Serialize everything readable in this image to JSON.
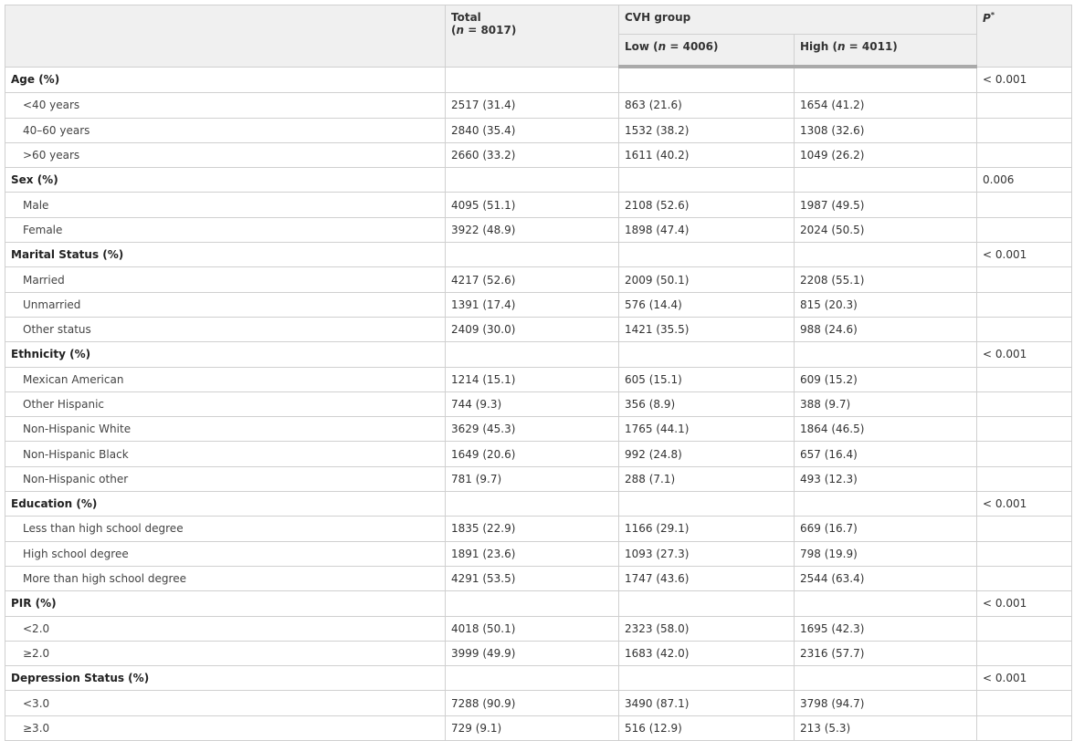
{
  "header": {
    "total_label": "Total",
    "total_n": "(n = 8017)",
    "cvh_group_label": "CVH group",
    "low_label": "Low (n = 4006)",
    "high_label": "High (n = 4011)",
    "p_label": "P",
    "p_sup": "*"
  },
  "rows": [
    {
      "type": "group",
      "label": "Age (%)",
      "total": "",
      "low": "",
      "high": "",
      "p": "< 0.001"
    },
    {
      "type": "item",
      "label": "<40 years",
      "total": "2517 (31.4)",
      "low": "863 (21.6)",
      "high": "1654 (41.2)",
      "p": ""
    },
    {
      "type": "item",
      "label": "40–60 years",
      "total": "2840 (35.4)",
      "low": "1532 (38.2)",
      "high": "1308 (32.6)",
      "p": ""
    },
    {
      "type": "item",
      "label": ">60 years",
      "total": "2660 (33.2)",
      "low": "1611 (40.2)",
      "high": "1049 (26.2)",
      "p": ""
    },
    {
      "type": "group",
      "label": "Sex (%)",
      "total": "",
      "low": "",
      "high": "",
      "p": "0.006"
    },
    {
      "type": "item",
      "label": "Male",
      "total": "4095 (51.1)",
      "low": "2108 (52.6)",
      "high": "1987 (49.5)",
      "p": ""
    },
    {
      "type": "item",
      "label": "Female",
      "total": "3922 (48.9)",
      "low": "1898 (47.4)",
      "high": "2024 (50.5)",
      "p": ""
    },
    {
      "type": "group",
      "label": "Marital Status (%)",
      "total": "",
      "low": "",
      "high": "",
      "p": "< 0.001"
    },
    {
      "type": "item",
      "label": "Married",
      "total": "4217 (52.6)",
      "low": "2009 (50.1)",
      "high": "2208 (55.1)",
      "p": ""
    },
    {
      "type": "item",
      "label": "Unmarried",
      "total": "1391 (17.4)",
      "low": "576 (14.4)",
      "high": "815 (20.3)",
      "p": ""
    },
    {
      "type": "item",
      "label": "Other status",
      "total": "2409 (30.0)",
      "low": "1421 (35.5)",
      "high": "988 (24.6)",
      "p": ""
    },
    {
      "type": "group",
      "label": "Ethnicity (%)",
      "total": "",
      "low": "",
      "high": "",
      "p": "< 0.001"
    },
    {
      "type": "item",
      "label": "Mexican American",
      "total": "1214 (15.1)",
      "low": "605 (15.1)",
      "high": "609 (15.2)",
      "p": ""
    },
    {
      "type": "item",
      "label": "Other Hispanic",
      "total": "744 (9.3)",
      "low": "356 (8.9)",
      "high": "388 (9.7)",
      "p": ""
    },
    {
      "type": "item",
      "label": "Non-Hispanic White",
      "total": "3629 (45.3)",
      "low": "1765 (44.1)",
      "high": "1864 (46.5)",
      "p": ""
    },
    {
      "type": "item",
      "label": "Non-Hispanic Black",
      "total": "1649 (20.6)",
      "low": "992 (24.8)",
      "high": "657 (16.4)",
      "p": ""
    },
    {
      "type": "item",
      "label": "Non-Hispanic other",
      "total": "781 (9.7)",
      "low": "288 (7.1)",
      "high": "493 (12.3)",
      "p": ""
    },
    {
      "type": "group",
      "label": "Education (%)",
      "total": "",
      "low": "",
      "high": "",
      "p": "< 0.001"
    },
    {
      "type": "item",
      "label": "Less than high school degree",
      "total": "1835 (22.9)",
      "low": "1166 (29.1)",
      "high": "669 (16.7)",
      "p": ""
    },
    {
      "type": "item",
      "label": "High school degree",
      "total": "1891 (23.6)",
      "low": "1093 (27.3)",
      "high": "798 (19.9)",
      "p": ""
    },
    {
      "type": "item",
      "label": "More than high school degree",
      "total": "4291 (53.5)",
      "low": "1747 (43.6)",
      "high": "2544 (63.4)",
      "p": ""
    },
    {
      "type": "group",
      "label": "PIR (%)",
      "total": "",
      "low": "",
      "high": "",
      "p": "< 0.001"
    },
    {
      "type": "item",
      "label": "<2.0",
      "total": "4018 (50.1)",
      "low": "2323 (58.0)",
      "high": "1695 (42.3)",
      "p": ""
    },
    {
      "type": "item",
      "label": "≥2.0",
      "total": "3999 (49.9)",
      "low": "1683 (42.0)",
      "high": "2316 (57.7)",
      "p": ""
    },
    {
      "type": "group",
      "label": "Depression Status (%)",
      "total": "",
      "low": "",
      "high": "",
      "p": "< 0.001"
    },
    {
      "type": "item",
      "label": "<3.0",
      "total": "7288 (90.9)",
      "low": "3490 (87.1)",
      "high": "3798 (94.7)",
      "p": ""
    },
    {
      "type": "item",
      "label": "≥3.0",
      "total": "729 (9.1)",
      "low": "516 (12.9)",
      "high": "213 (5.3)",
      "p": ""
    }
  ]
}
